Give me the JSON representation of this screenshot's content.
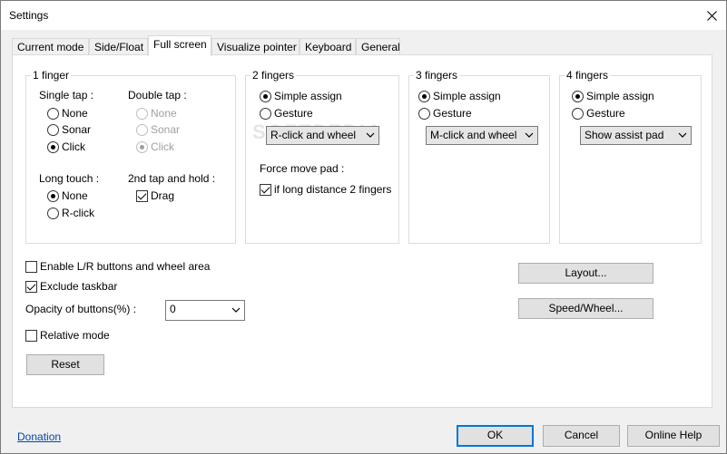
{
  "window": {
    "title": "Settings"
  },
  "tabs": [
    "Current mode",
    "Side/Float",
    "Full screen",
    "Visualize pointer",
    "Keyboard",
    "General"
  ],
  "one_finger": {
    "title": "1 finger",
    "single_tap_label": "Single tap :",
    "single_tap_options": [
      "None",
      "Sonar",
      "Click"
    ],
    "single_tap_selected": "Click",
    "double_tap_label": "Double tap :",
    "double_tap_options": [
      "None",
      "Sonar",
      "Click"
    ],
    "double_tap_selected": "Click",
    "long_touch_label": "Long touch :",
    "long_touch_options": [
      "None",
      "R-click"
    ],
    "long_touch_selected": "None",
    "second_tap_label": "2nd tap and hold :",
    "drag_label": "Drag",
    "drag_checked": true
  },
  "two_fingers": {
    "title": "2 fingers",
    "simple_assign_label": "Simple assign",
    "gesture_label": "Gesture",
    "selected": "Simple assign",
    "dropdown_value": "R-click and wheel",
    "force_move_label": "Force move pad :",
    "long_distance_label": "if long distance 2 fingers",
    "long_distance_checked": true
  },
  "three_fingers": {
    "title": "3 fingers",
    "simple_assign_label": "Simple assign",
    "gesture_label": "Gesture",
    "selected": "Simple assign",
    "dropdown_value": "M-click and wheel"
  },
  "four_fingers": {
    "title": "4 fingers",
    "simple_assign_label": "Simple assign",
    "gesture_label": "Gesture",
    "selected": "Simple assign",
    "dropdown_value": "Show assist pad"
  },
  "options": {
    "enable_lr_label": "Enable L/R buttons and wheel area",
    "enable_lr_checked": false,
    "exclude_taskbar_label": "Exclude taskbar",
    "exclude_taskbar_checked": true,
    "opacity_label": "Opacity of buttons(%) :",
    "opacity_value": "0",
    "relative_mode_label": "Relative mode",
    "relative_mode_checked": false,
    "reset_label": "Reset",
    "layout_label": "Layout...",
    "speed_wheel_label": "Speed/Wheel..."
  },
  "footer": {
    "donation_label": "Donation",
    "ok_label": "OK",
    "cancel_label": "Cancel",
    "online_help_label": "Online Help"
  },
  "watermark": "SOFTPEDIA",
  "colors": {
    "link": "#0645ad",
    "default_button_border": "#0078d7"
  }
}
